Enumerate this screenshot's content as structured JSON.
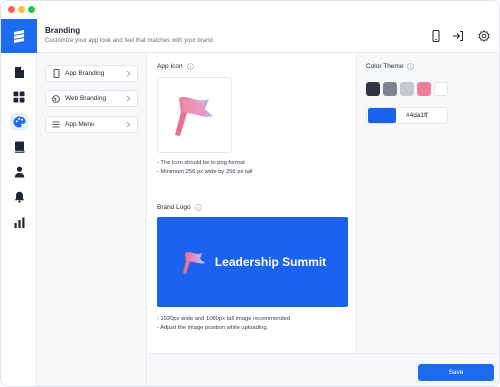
{
  "header": {
    "title": "Branding",
    "subtitle": "Customize your app look and feel that matches with your brand."
  },
  "nav": {
    "items": [
      {
        "label": "App Branding",
        "icon": "phone-icon"
      },
      {
        "label": "Web Branding",
        "icon": "globe-icon"
      },
      {
        "label": "App Menu",
        "icon": "menu-list-icon"
      }
    ]
  },
  "app_icon": {
    "label": "App Icon",
    "notes": [
      "- The icon should be in png format",
      "- Minimum 256 px wide by 256 px tall"
    ]
  },
  "brand_logo": {
    "label": "Brand Logo",
    "banner_text": "Leadership Summit",
    "notes": [
      "- 1920px wide and 1080px tall image recommended.",
      "- Adjust the image position while uploading."
    ]
  },
  "color_theme": {
    "label": "Color Theme",
    "swatches": [
      "#2f3446",
      "#7c8393",
      "#c5c9d1",
      "#ee7f9a",
      "#ffffff"
    ],
    "selected_color": "#1c62f0",
    "hex_value": "#4da1ff"
  },
  "footer": {
    "save_label": "Save"
  },
  "colors": {
    "accent": "#1c6bf2"
  }
}
